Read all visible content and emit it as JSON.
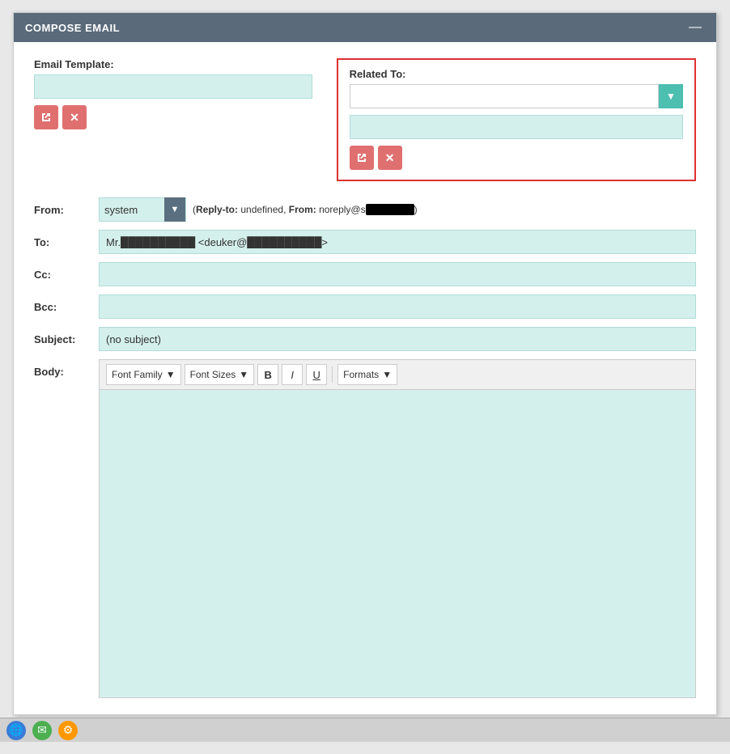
{
  "window": {
    "title": "COMPOSE EMAIL",
    "minimize_icon": "—"
  },
  "email_template": {
    "label": "Email Template:",
    "placeholder": "",
    "btn_link_icon": "⊞",
    "btn_clear_icon": "✕"
  },
  "related_to": {
    "label": "Related To:",
    "dropdown_placeholder": "",
    "dropdown_arrow": "▼",
    "text_placeholder": "",
    "btn_link_icon": "⊞",
    "btn_clear_icon": "✕"
  },
  "from": {
    "label": "From:",
    "value": "system",
    "reply_to_label": "(Reply-to:",
    "reply_to_value": "undefined,",
    "from_label": "From:",
    "from_value": "noreply@s",
    "from_redacted": "██████████",
    "from_close": ")",
    "arrow": "▼"
  },
  "to": {
    "label": "To:",
    "value": "Mr.██████████ <deuker@██████████>"
  },
  "cc": {
    "label": "Cc:",
    "value": ""
  },
  "bcc": {
    "label": "Bcc:",
    "value": ""
  },
  "subject": {
    "label": "Subject:",
    "value": "(no subject)"
  },
  "body": {
    "label": "Body:",
    "toolbar": {
      "font_family_label": "Font Family",
      "font_family_arrow": "▼",
      "font_sizes_label": "Font Sizes",
      "font_sizes_arrow": "▼",
      "bold_label": "B",
      "italic_label": "I",
      "underline_label": "U",
      "formats_label": "Formats",
      "formats_arrow": "▼"
    }
  }
}
